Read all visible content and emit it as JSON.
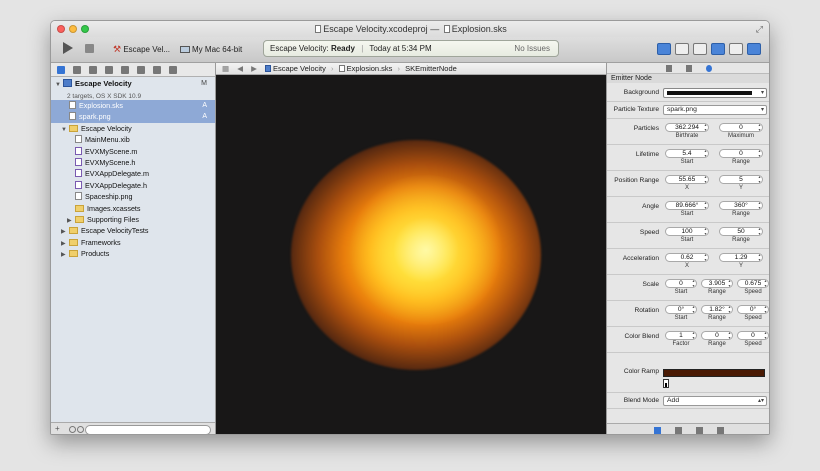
{
  "window": {
    "title": "Escape Velocity.xcodeproj",
    "title_sep": "—",
    "document": "Explosion.sks"
  },
  "toolbar": {
    "scheme": "Escape Vel...",
    "destination": "My Mac 64-bit",
    "activity": {
      "project": "Escape Velocity:",
      "status": "Ready",
      "time": "Today at 5:34 PM",
      "issues": "No Issues"
    }
  },
  "navigator": {
    "project": {
      "name": "Escape Velocity",
      "subtitle": "2 targets, OS X SDK 10.9",
      "badge": "M"
    },
    "items": [
      {
        "label": "Explosion.sks",
        "badge": "A",
        "selected": true,
        "indent": 1,
        "icon": "file"
      },
      {
        "label": "spark.png",
        "badge": "A",
        "selected": true,
        "indent": 1,
        "icon": "file"
      },
      {
        "label": "Escape Velocity",
        "badge": "",
        "selected": false,
        "indent": 1,
        "icon": "folder",
        "disclosure": "open"
      },
      {
        "label": "MainMenu.xib",
        "badge": "",
        "selected": false,
        "indent": 2,
        "icon": "file"
      },
      {
        "label": "EVXMyScene.m",
        "badge": "",
        "selected": false,
        "indent": 2,
        "icon": "m"
      },
      {
        "label": "EVXMyScene.h",
        "badge": "",
        "selected": false,
        "indent": 2,
        "icon": "m"
      },
      {
        "label": "EVXAppDelegate.m",
        "badge": "",
        "selected": false,
        "indent": 2,
        "icon": "m"
      },
      {
        "label": "EVXAppDelegate.h",
        "badge": "",
        "selected": false,
        "indent": 2,
        "icon": "m"
      },
      {
        "label": "Spaceship.png",
        "badge": "",
        "selected": false,
        "indent": 2,
        "icon": "file"
      },
      {
        "label": "Images.xcassets",
        "badge": "",
        "selected": false,
        "indent": 2,
        "icon": "folder"
      },
      {
        "label": "Supporting Files",
        "badge": "",
        "selected": false,
        "indent": 2,
        "icon": "folder",
        "disclosure": "closed"
      },
      {
        "label": "Escape VelocityTests",
        "badge": "",
        "selected": false,
        "indent": 1,
        "icon": "folder",
        "disclosure": "closed"
      },
      {
        "label": "Frameworks",
        "badge": "",
        "selected": false,
        "indent": 1,
        "icon": "folder",
        "disclosure": "closed"
      },
      {
        "label": "Products",
        "badge": "",
        "selected": false,
        "indent": 1,
        "icon": "folder",
        "disclosure": "closed"
      }
    ]
  },
  "jumpbar": {
    "crumbs": [
      "Escape Velocity",
      "Explosion.sks",
      "SKEmitterNode"
    ]
  },
  "inspector": {
    "section_title": "Emitter Node",
    "background_label": "Background",
    "background_color": "#111111",
    "texture": {
      "label": "Particle Texture",
      "value": "spark.png"
    },
    "rows": [
      {
        "label": "Particles",
        "fields": [
          {
            "value": "362.294",
            "sub": "Birthrate"
          },
          {
            "value": "0",
            "sub": "Maximum"
          }
        ]
      },
      {
        "label": "Lifetime",
        "fields": [
          {
            "value": "5.4",
            "sub": "Start"
          },
          {
            "value": "0",
            "sub": "Range"
          }
        ]
      },
      {
        "label": "Position Range",
        "fields": [
          {
            "value": "55.65",
            "sub": "X"
          },
          {
            "value": "5",
            "sub": "Y"
          }
        ]
      },
      {
        "label": "Angle",
        "fields": [
          {
            "value": "89.666°",
            "sub": "Start"
          },
          {
            "value": "360°",
            "sub": "Range"
          }
        ]
      },
      {
        "label": "Speed",
        "fields": [
          {
            "value": "100",
            "sub": "Start"
          },
          {
            "value": "50",
            "sub": "Range"
          }
        ]
      },
      {
        "label": "Acceleration",
        "fields": [
          {
            "value": "0.62",
            "sub": "X"
          },
          {
            "value": "1.29",
            "sub": "Y"
          }
        ]
      },
      {
        "label": "Scale",
        "fields": [
          {
            "value": "0",
            "sub": "Start"
          },
          {
            "value": "3.905",
            "sub": "Range"
          },
          {
            "value": "0.675",
            "sub": "Speed"
          }
        ]
      },
      {
        "label": "Rotation",
        "fields": [
          {
            "value": "0°",
            "sub": "Start"
          },
          {
            "value": "1.82°",
            "sub": "Range"
          },
          {
            "value": "0°",
            "sub": "Speed"
          }
        ]
      },
      {
        "label": "Color Blend",
        "fields": [
          {
            "value": "1",
            "sub": "Factor"
          },
          {
            "value": "0",
            "sub": "Range"
          },
          {
            "value": "0",
            "sub": "Speed"
          }
        ]
      }
    ],
    "color_ramp_label": "Color Ramp",
    "color_ramp_color": "#4a1a04",
    "blend": {
      "label": "Blend Mode",
      "value": "Add"
    }
  }
}
